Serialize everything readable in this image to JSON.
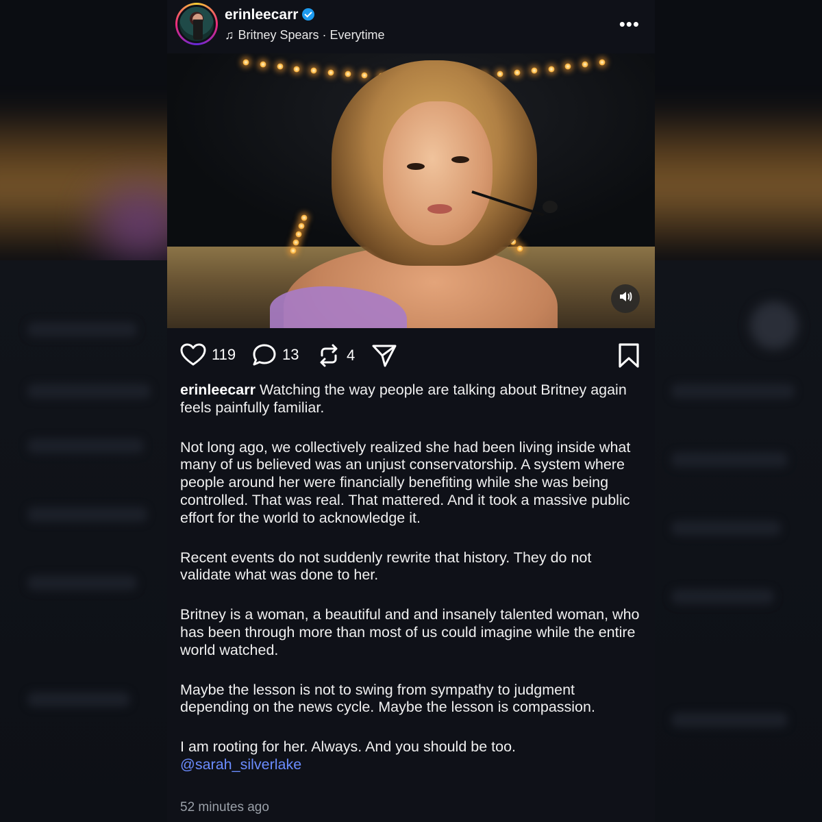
{
  "post": {
    "username": "erinleecarr",
    "music": "Britney Spears · Everytime",
    "likes": "119",
    "comments": "13",
    "reposts": "4",
    "caption_lead": "Watching the way people are talking about Britney again feels painfully familiar.",
    "paragraphs": [
      "Not long ago, we collectively realized she had been living inside what many of us believed was an unjust conservatorship. A system where people around her were financially benefiting while she was being controlled. That was real. That mattered. And it took a massive public effort for the world to acknowledge it.",
      "Recent events do not suddenly rewrite that history. They do not validate what was done to her.",
      "Britney is a woman, a beautiful and and insanely talented woman, who has been through more than most of us could imagine while the entire world watched.",
      "Maybe the lesson is not to swing from sympathy to judgment depending on the news cycle. Maybe the lesson is compassion.",
      "I am rooting for her. Always. And you should be too."
    ],
    "mention": "@sarah_silverlake",
    "timestamp": "52 minutes ago"
  },
  "icons": {
    "music": "music-note-icon",
    "more": "more-options-icon",
    "sound": "speaker-icon",
    "like": "heart-icon",
    "comment": "comment-icon",
    "repost": "repost-icon",
    "share": "send-icon",
    "save": "bookmark-icon"
  },
  "colors": {
    "card_bg": "#0f1118",
    "mention": "#6b8cff",
    "verified": "#1d9bf0",
    "timestamp": "#9aa0a8"
  }
}
